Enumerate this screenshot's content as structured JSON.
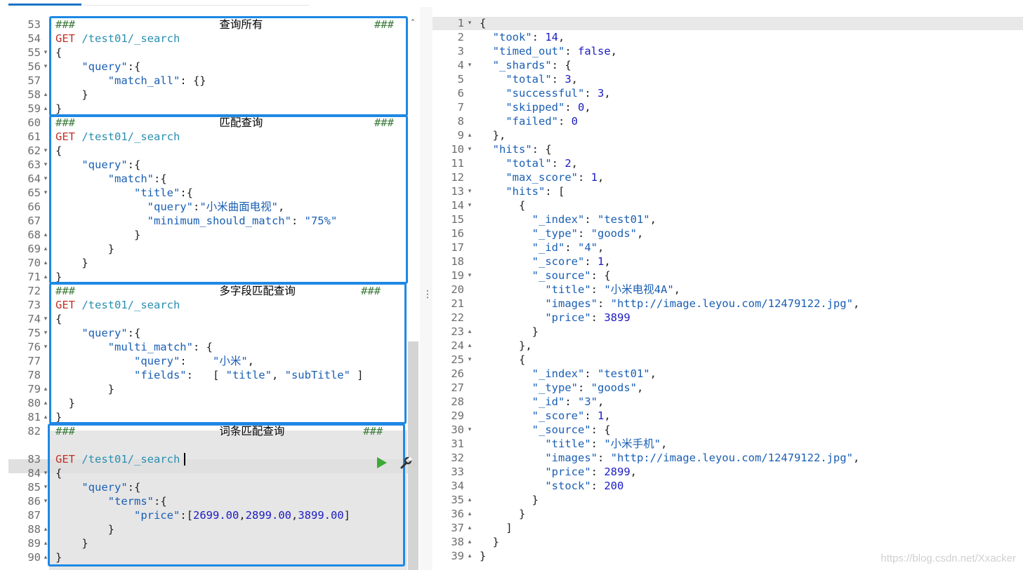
{
  "left_lines": [
    {
      "num": "53",
      "fold": "",
      "parts": [
        [
          "c",
          "###"
        ],
        [
          "c",
          "                      "
        ],
        [
          "cn",
          "查询所有"
        ],
        [
          "c",
          "                 ###"
        ]
      ]
    },
    {
      "num": "54",
      "fold": "",
      "parts": [
        [
          "m",
          "GET "
        ],
        [
          "u",
          "/test01/_search"
        ]
      ]
    },
    {
      "num": "55",
      "fold": "▾",
      "parts": [
        [
          "p",
          "{"
        ]
      ]
    },
    {
      "num": "56",
      "fold": "▾",
      "parts": [
        [
          "p",
          "    "
        ],
        [
          "k",
          "\"query\""
        ],
        [
          "p",
          ":{"
        ]
      ]
    },
    {
      "num": "57",
      "fold": "",
      "parts": [
        [
          "p",
          "        "
        ],
        [
          "k",
          "\"match_all\""
        ],
        [
          "p",
          ": {}"
        ]
      ]
    },
    {
      "num": "58",
      "fold": "▴",
      "parts": [
        [
          "p",
          "    }"
        ]
      ]
    },
    {
      "num": "59",
      "fold": "▴",
      "parts": [
        [
          "p",
          "}"
        ]
      ]
    },
    {
      "num": "60",
      "fold": "",
      "parts": [
        [
          "c",
          "###"
        ],
        [
          "c",
          "                      "
        ],
        [
          "cn",
          "匹配查询"
        ],
        [
          "c",
          "                 ###"
        ]
      ]
    },
    {
      "num": "61",
      "fold": "",
      "parts": [
        [
          "m",
          "GET "
        ],
        [
          "u",
          "/test01/_search"
        ]
      ]
    },
    {
      "num": "62",
      "fold": "▾",
      "parts": [
        [
          "p",
          "{"
        ]
      ]
    },
    {
      "num": "63",
      "fold": "▾",
      "parts": [
        [
          "p",
          "    "
        ],
        [
          "k",
          "\"query\""
        ],
        [
          "p",
          ":{"
        ]
      ]
    },
    {
      "num": "64",
      "fold": "▾",
      "parts": [
        [
          "p",
          "        "
        ],
        [
          "k",
          "\"match\""
        ],
        [
          "p",
          ":{"
        ]
      ]
    },
    {
      "num": "65",
      "fold": "▾",
      "parts": [
        [
          "p",
          "            "
        ],
        [
          "k",
          "\"title\""
        ],
        [
          "p",
          ":{"
        ]
      ]
    },
    {
      "num": "66",
      "fold": "",
      "parts": [
        [
          "p",
          "              "
        ],
        [
          "k",
          "\"query\""
        ],
        [
          "p",
          ":"
        ],
        [
          "s",
          "\"小米曲面电视\""
        ],
        [
          "p",
          ","
        ]
      ]
    },
    {
      "num": "67",
      "fold": "",
      "parts": [
        [
          "p",
          "              "
        ],
        [
          "k",
          "\"minimum_should_match\""
        ],
        [
          "p",
          ": "
        ],
        [
          "s",
          "\"75%\""
        ]
      ]
    },
    {
      "num": "68",
      "fold": "▴",
      "parts": [
        [
          "p",
          "            }"
        ]
      ]
    },
    {
      "num": "69",
      "fold": "▴",
      "parts": [
        [
          "p",
          "        }"
        ]
      ]
    },
    {
      "num": "70",
      "fold": "▴",
      "parts": [
        [
          "p",
          "    }"
        ]
      ]
    },
    {
      "num": "71",
      "fold": "▴",
      "parts": [
        [
          "p",
          "}"
        ]
      ]
    },
    {
      "num": "72",
      "fold": "",
      "parts": [
        [
          "c",
          "###"
        ],
        [
          "c",
          "                      "
        ],
        [
          "cn",
          "多字段匹配查询"
        ],
        [
          "c",
          "          ###"
        ]
      ]
    },
    {
      "num": "73",
      "fold": "",
      "parts": [
        [
          "m",
          "GET "
        ],
        [
          "u",
          "/test01/_search"
        ]
      ]
    },
    {
      "num": "74",
      "fold": "▾",
      "parts": [
        [
          "p",
          "{"
        ]
      ]
    },
    {
      "num": "75",
      "fold": "▾",
      "parts": [
        [
          "p",
          "    "
        ],
        [
          "k",
          "\"query\""
        ],
        [
          "p",
          ":{"
        ]
      ]
    },
    {
      "num": "76",
      "fold": "▾",
      "parts": [
        [
          "p",
          "        "
        ],
        [
          "k",
          "\"multi_match\""
        ],
        [
          "p",
          ": {"
        ]
      ]
    },
    {
      "num": "77",
      "fold": "",
      "parts": [
        [
          "p",
          "            "
        ],
        [
          "k",
          "\"query\""
        ],
        [
          "p",
          ":    "
        ],
        [
          "s",
          "\"小米\""
        ],
        [
          "p",
          ","
        ]
      ]
    },
    {
      "num": "78",
      "fold": "",
      "parts": [
        [
          "p",
          "            "
        ],
        [
          "k",
          "\"fields\""
        ],
        [
          "p",
          ":   [ "
        ],
        [
          "s",
          "\"title\""
        ],
        [
          "p",
          ", "
        ],
        [
          "s",
          "\"subTitle\""
        ],
        [
          "p",
          " ]"
        ]
      ]
    },
    {
      "num": "79",
      "fold": "▴",
      "parts": [
        [
          "p",
          "        }"
        ]
      ]
    },
    {
      "num": "80",
      "fold": "▴",
      "parts": [
        [
          "p",
          "  }"
        ]
      ]
    },
    {
      "num": "81",
      "fold": "▴",
      "parts": [
        [
          "p",
          "}"
        ]
      ]
    },
    {
      "num": "82",
      "fold": "",
      "parts": [
        [
          "c",
          "###"
        ],
        [
          "c",
          "                      "
        ],
        [
          "cn",
          "词条匹配查询"
        ],
        [
          "c",
          "            ###"
        ]
      ]
    },
    {
      "num": "",
      "fold": "",
      "parts": []
    },
    {
      "num": "83",
      "fold": "",
      "parts": [
        [
          "m",
          "GET "
        ],
        [
          "u",
          "/test01/_search"
        ]
      ]
    },
    {
      "num": "84",
      "fold": "▾",
      "parts": [
        [
          "p",
          "{"
        ]
      ]
    },
    {
      "num": "85",
      "fold": "▾",
      "parts": [
        [
          "p",
          "    "
        ],
        [
          "k",
          "\"query\""
        ],
        [
          "p",
          ":{"
        ]
      ]
    },
    {
      "num": "86",
      "fold": "▾",
      "parts": [
        [
          "p",
          "        "
        ],
        [
          "k",
          "\"terms\""
        ],
        [
          "p",
          ":{"
        ]
      ]
    },
    {
      "num": "87",
      "fold": "",
      "parts": [
        [
          "p",
          "            "
        ],
        [
          "k",
          "\"price\""
        ],
        [
          "p",
          ":["
        ],
        [
          "n",
          "2699.00"
        ],
        [
          "p",
          ","
        ],
        [
          "n",
          "2899.00"
        ],
        [
          "p",
          ","
        ],
        [
          "n",
          "3899.00"
        ],
        [
          "p",
          "]"
        ]
      ]
    },
    {
      "num": "88",
      "fold": "▴",
      "parts": [
        [
          "p",
          "        }"
        ]
      ]
    },
    {
      "num": "89",
      "fold": "▴",
      "parts": [
        [
          "p",
          "    }"
        ]
      ]
    },
    {
      "num": "90",
      "fold": "▴",
      "parts": [
        [
          "p",
          "}"
        ]
      ]
    }
  ],
  "right_lines": [
    {
      "num": "1",
      "fold": "▾",
      "parts": [
        [
          "p",
          "{"
        ]
      ]
    },
    {
      "num": "2",
      "fold": "",
      "parts": [
        [
          "p",
          "  "
        ],
        [
          "k",
          "\"took\""
        ],
        [
          "p",
          ": "
        ],
        [
          "n",
          "14"
        ],
        [
          "p",
          ","
        ]
      ]
    },
    {
      "num": "3",
      "fold": "",
      "parts": [
        [
          "p",
          "  "
        ],
        [
          "k",
          "\"timed_out\""
        ],
        [
          "p",
          ": "
        ],
        [
          "n",
          "false"
        ],
        [
          "p",
          ","
        ]
      ]
    },
    {
      "num": "4",
      "fold": "▾",
      "parts": [
        [
          "p",
          "  "
        ],
        [
          "k",
          "\"_shards\""
        ],
        [
          "p",
          ": {"
        ]
      ]
    },
    {
      "num": "5",
      "fold": "",
      "parts": [
        [
          "p",
          "    "
        ],
        [
          "k",
          "\"total\""
        ],
        [
          "p",
          ": "
        ],
        [
          "n",
          "3"
        ],
        [
          "p",
          ","
        ]
      ]
    },
    {
      "num": "6",
      "fold": "",
      "parts": [
        [
          "p",
          "    "
        ],
        [
          "k",
          "\"successful\""
        ],
        [
          "p",
          ": "
        ],
        [
          "n",
          "3"
        ],
        [
          "p",
          ","
        ]
      ]
    },
    {
      "num": "7",
      "fold": "",
      "parts": [
        [
          "p",
          "    "
        ],
        [
          "k",
          "\"skipped\""
        ],
        [
          "p",
          ": "
        ],
        [
          "n",
          "0"
        ],
        [
          "p",
          ","
        ]
      ]
    },
    {
      "num": "8",
      "fold": "",
      "parts": [
        [
          "p",
          "    "
        ],
        [
          "k",
          "\"failed\""
        ],
        [
          "p",
          ": "
        ],
        [
          "n",
          "0"
        ]
      ]
    },
    {
      "num": "9",
      "fold": "▴",
      "parts": [
        [
          "p",
          "  },"
        ]
      ]
    },
    {
      "num": "10",
      "fold": "▾",
      "parts": [
        [
          "p",
          "  "
        ],
        [
          "k",
          "\"hits\""
        ],
        [
          "p",
          ": {"
        ]
      ]
    },
    {
      "num": "11",
      "fold": "",
      "parts": [
        [
          "p",
          "    "
        ],
        [
          "k",
          "\"total\""
        ],
        [
          "p",
          ": "
        ],
        [
          "n",
          "2"
        ],
        [
          "p",
          ","
        ]
      ]
    },
    {
      "num": "12",
      "fold": "",
      "parts": [
        [
          "p",
          "    "
        ],
        [
          "k",
          "\"max_score\""
        ],
        [
          "p",
          ": "
        ],
        [
          "n",
          "1"
        ],
        [
          "p",
          ","
        ]
      ]
    },
    {
      "num": "13",
      "fold": "▾",
      "parts": [
        [
          "p",
          "    "
        ],
        [
          "k",
          "\"hits\""
        ],
        [
          "p",
          ": ["
        ]
      ]
    },
    {
      "num": "14",
      "fold": "▾",
      "parts": [
        [
          "p",
          "      {"
        ]
      ]
    },
    {
      "num": "15",
      "fold": "",
      "parts": [
        [
          "p",
          "        "
        ],
        [
          "k",
          "\"_index\""
        ],
        [
          "p",
          ": "
        ],
        [
          "s",
          "\"test01\""
        ],
        [
          "p",
          ","
        ]
      ]
    },
    {
      "num": "16",
      "fold": "",
      "parts": [
        [
          "p",
          "        "
        ],
        [
          "k",
          "\"_type\""
        ],
        [
          "p",
          ": "
        ],
        [
          "s",
          "\"goods\""
        ],
        [
          "p",
          ","
        ]
      ]
    },
    {
      "num": "17",
      "fold": "",
      "parts": [
        [
          "p",
          "        "
        ],
        [
          "k",
          "\"_id\""
        ],
        [
          "p",
          ": "
        ],
        [
          "s",
          "\"4\""
        ],
        [
          "p",
          ","
        ]
      ]
    },
    {
      "num": "18",
      "fold": "",
      "parts": [
        [
          "p",
          "        "
        ],
        [
          "k",
          "\"_score\""
        ],
        [
          "p",
          ": "
        ],
        [
          "n",
          "1"
        ],
        [
          "p",
          ","
        ]
      ]
    },
    {
      "num": "19",
      "fold": "▾",
      "parts": [
        [
          "p",
          "        "
        ],
        [
          "k",
          "\"_source\""
        ],
        [
          "p",
          ": {"
        ]
      ]
    },
    {
      "num": "20",
      "fold": "",
      "parts": [
        [
          "p",
          "          "
        ],
        [
          "k",
          "\"title\""
        ],
        [
          "p",
          ": "
        ],
        [
          "s",
          "\"小米电视4A\""
        ],
        [
          "p",
          ","
        ]
      ]
    },
    {
      "num": "21",
      "fold": "",
      "parts": [
        [
          "p",
          "          "
        ],
        [
          "k",
          "\"images\""
        ],
        [
          "p",
          ": "
        ],
        [
          "s",
          "\"http://image.leyou.com/12479122.jpg\""
        ],
        [
          "p",
          ","
        ]
      ]
    },
    {
      "num": "22",
      "fold": "",
      "parts": [
        [
          "p",
          "          "
        ],
        [
          "k",
          "\"price\""
        ],
        [
          "p",
          ": "
        ],
        [
          "n",
          "3899"
        ]
      ]
    },
    {
      "num": "23",
      "fold": "▴",
      "parts": [
        [
          "p",
          "        }"
        ]
      ]
    },
    {
      "num": "24",
      "fold": "▴",
      "parts": [
        [
          "p",
          "      },"
        ]
      ]
    },
    {
      "num": "25",
      "fold": "▾",
      "parts": [
        [
          "p",
          "      {"
        ]
      ]
    },
    {
      "num": "26",
      "fold": "",
      "parts": [
        [
          "p",
          "        "
        ],
        [
          "k",
          "\"_index\""
        ],
        [
          "p",
          ": "
        ],
        [
          "s",
          "\"test01\""
        ],
        [
          "p",
          ","
        ]
      ]
    },
    {
      "num": "27",
      "fold": "",
      "parts": [
        [
          "p",
          "        "
        ],
        [
          "k",
          "\"_type\""
        ],
        [
          "p",
          ": "
        ],
        [
          "s",
          "\"goods\""
        ],
        [
          "p",
          ","
        ]
      ]
    },
    {
      "num": "28",
      "fold": "",
      "parts": [
        [
          "p",
          "        "
        ],
        [
          "k",
          "\"_id\""
        ],
        [
          "p",
          ": "
        ],
        [
          "s",
          "\"3\""
        ],
        [
          "p",
          ","
        ]
      ]
    },
    {
      "num": "29",
      "fold": "",
      "parts": [
        [
          "p",
          "        "
        ],
        [
          "k",
          "\"_score\""
        ],
        [
          "p",
          ": "
        ],
        [
          "n",
          "1"
        ],
        [
          "p",
          ","
        ]
      ]
    },
    {
      "num": "30",
      "fold": "▾",
      "parts": [
        [
          "p",
          "        "
        ],
        [
          "k",
          "\"_source\""
        ],
        [
          "p",
          ": {"
        ]
      ]
    },
    {
      "num": "31",
      "fold": "",
      "parts": [
        [
          "p",
          "          "
        ],
        [
          "k",
          "\"title\""
        ],
        [
          "p",
          ": "
        ],
        [
          "s",
          "\"小米手机\""
        ],
        [
          "p",
          ","
        ]
      ]
    },
    {
      "num": "32",
      "fold": "",
      "parts": [
        [
          "p",
          "          "
        ],
        [
          "k",
          "\"images\""
        ],
        [
          "p",
          ": "
        ],
        [
          "s",
          "\"http://image.leyou.com/12479122.jpg\""
        ],
        [
          "p",
          ","
        ]
      ]
    },
    {
      "num": "33",
      "fold": "",
      "parts": [
        [
          "p",
          "          "
        ],
        [
          "k",
          "\"price\""
        ],
        [
          "p",
          ": "
        ],
        [
          "n",
          "2899"
        ],
        [
          "p",
          ","
        ]
      ]
    },
    {
      "num": "34",
      "fold": "",
      "parts": [
        [
          "p",
          "          "
        ],
        [
          "k",
          "\"stock\""
        ],
        [
          "p",
          ": "
        ],
        [
          "n",
          "200"
        ]
      ]
    },
    {
      "num": "35",
      "fold": "▴",
      "parts": [
        [
          "p",
          "        }"
        ]
      ]
    },
    {
      "num": "36",
      "fold": "▴",
      "parts": [
        [
          "p",
          "      }"
        ]
      ]
    },
    {
      "num": "37",
      "fold": "▴",
      "parts": [
        [
          "p",
          "    ]"
        ]
      ]
    },
    {
      "num": "38",
      "fold": "▴",
      "parts": [
        [
          "p",
          "  }"
        ]
      ]
    },
    {
      "num": "39",
      "fold": "▴",
      "parts": [
        [
          "p",
          "}"
        ]
      ]
    }
  ],
  "watermark": "https://blog.csdn.net/Xxacker",
  "colors": {
    "block_border": "#1e88e5",
    "run_button": "#3aaa35"
  },
  "icons": {
    "run": "play-icon",
    "settings": "wrench-icon",
    "scroll": "chevron-up-icon",
    "splitter": "vertical-dots-icon"
  }
}
